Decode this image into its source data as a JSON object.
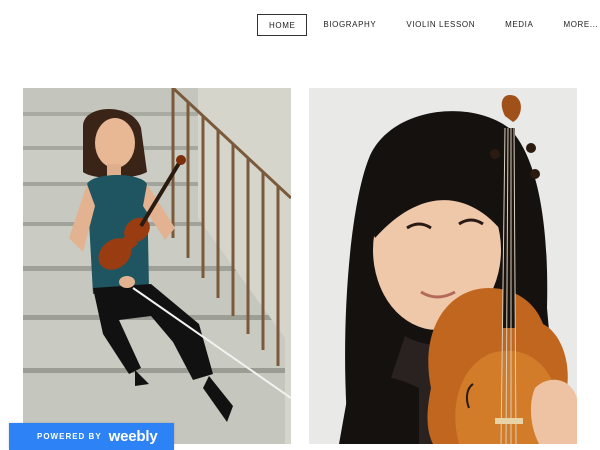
{
  "nav": {
    "items": [
      {
        "label": "HOME",
        "active": true
      },
      {
        "label": "BIOGRAPHY"
      },
      {
        "label": "VIOLIN LESSON"
      },
      {
        "label": "MEDIA"
      },
      {
        "label": "MORE..."
      }
    ]
  },
  "photos": [
    {
      "subject": "violinist-seated-on-stairs-with-violin-and-bow"
    },
    {
      "subject": "violinist-portrait-holding-violin"
    }
  ],
  "badge": {
    "powered_by": "POWERED BY",
    "brand": "weebly"
  },
  "colors": {
    "badge_bg": "#2d83f6",
    "nav_text": "#222222",
    "page_bg": "#ffffff"
  }
}
